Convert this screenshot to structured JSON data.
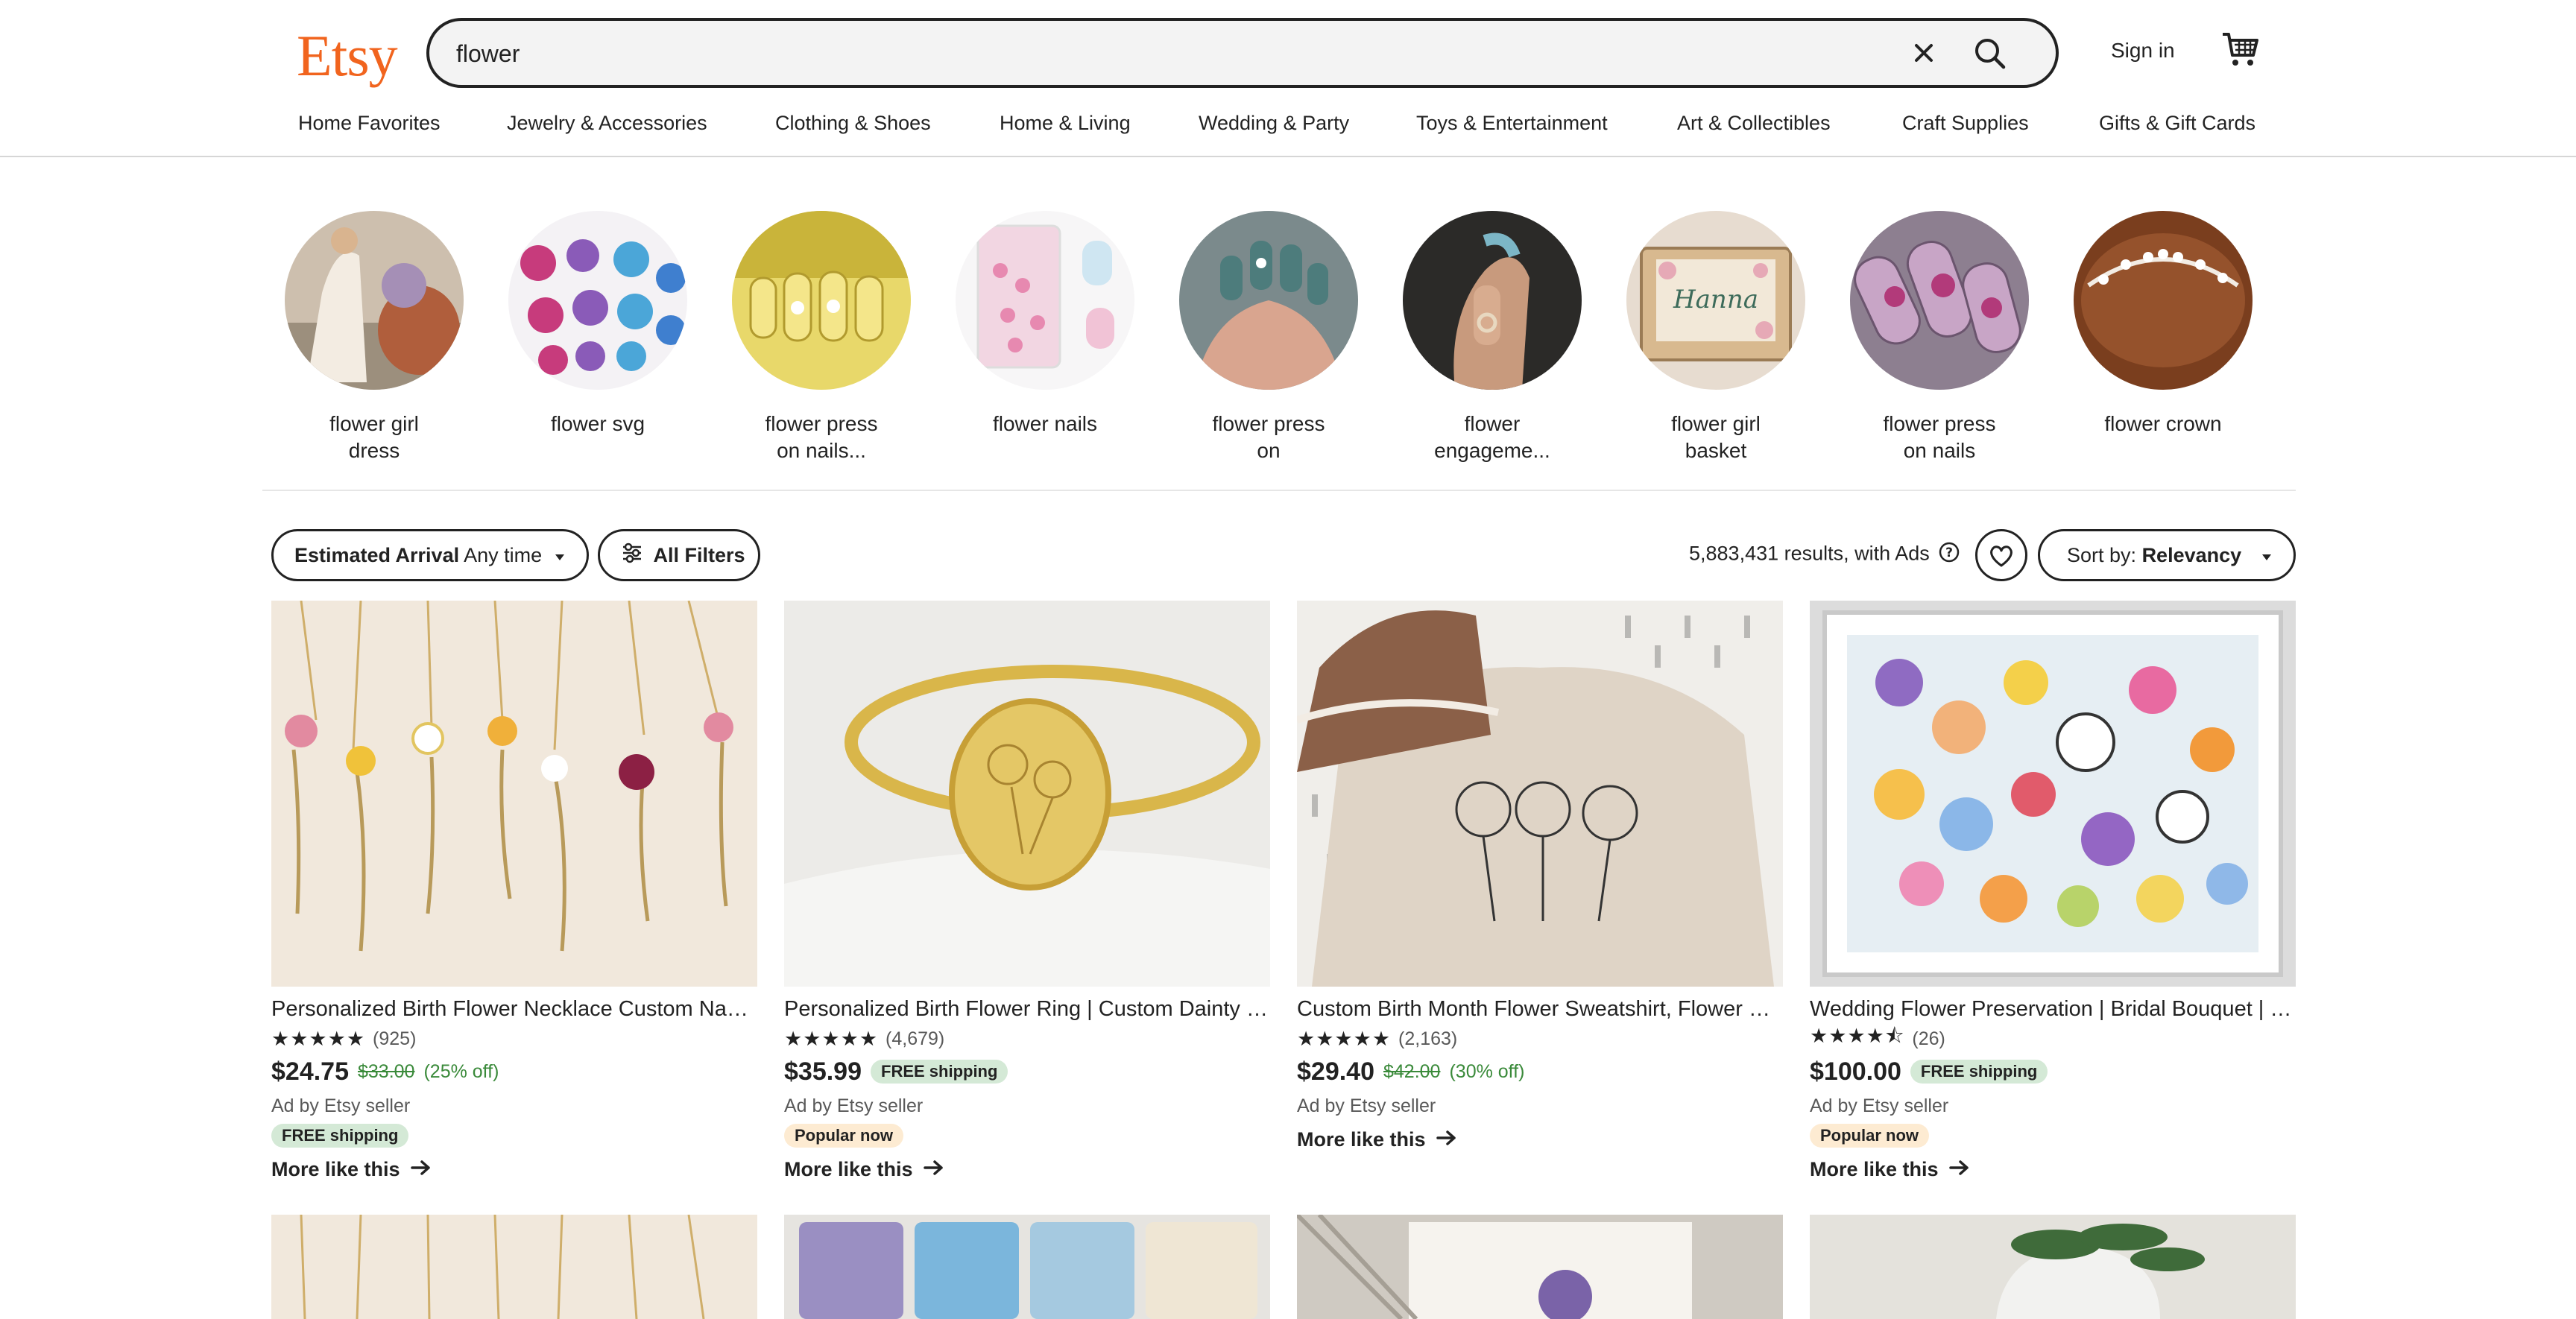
{
  "header": {
    "logo": "Etsy",
    "search": {
      "value": "flower"
    },
    "sign_in": "Sign in",
    "icons": {
      "clear": "close-icon",
      "search": "search-icon",
      "cart": "cart-icon"
    },
    "brand_color": "#f1641e"
  },
  "categories": [
    "Home Favorites",
    "Jewelry & Accessories",
    "Clothing & Shoes",
    "Home & Living",
    "Wedding & Party",
    "Toys & Entertainment",
    "Art & Collectibles",
    "Craft Supplies",
    "Gifts & Gift Cards"
  ],
  "suggestions": [
    {
      "line1": "flower girl",
      "line2": "dress"
    },
    {
      "line1": "flower svg",
      "line2": ""
    },
    {
      "line1": "flower press",
      "line2": "on nails..."
    },
    {
      "line1": "flower nails",
      "line2": ""
    },
    {
      "line1": "flower press",
      "line2": "on"
    },
    {
      "line1": "flower",
      "line2": "engageme..."
    },
    {
      "line1": "flower girl",
      "line2": "basket"
    },
    {
      "line1": "flower press",
      "line2": "on nails"
    },
    {
      "line1": "flower crown",
      "line2": ""
    }
  ],
  "filters": {
    "arrival_label": "Estimated Arrival",
    "arrival_value": "Any time",
    "all_filters": "All Filters",
    "results": "5,883,431 results,",
    "with_ads": "with Ads",
    "sort_label": "Sort by:",
    "sort_value": "Relevancy"
  },
  "listings": [
    {
      "title": "Personalized Birth Flower Necklace Custom Name Necklace",
      "stars": "★★★★★",
      "reviews": "(925)",
      "price": "$24.75",
      "original": "$33.00",
      "discount": "(25% off)",
      "seller": "Ad by Etsy seller",
      "badge": "FREE shipping",
      "more": "More like this"
    },
    {
      "title": "Personalized Birth Flower Ring | Custom Dainty Signet Ring",
      "stars": "★★★★★",
      "reviews": "(4,679)",
      "price": "$35.99",
      "ship_badge": "FREE shipping",
      "seller": "Ad by Etsy seller",
      "badge": "Popular now",
      "more": "More like this"
    },
    {
      "title": "Custom Birth Month Flower Sweatshirt, Flower Bouquet Sweatshirt",
      "stars": "★★★★★",
      "reviews": "(2,163)",
      "price": "$29.40",
      "original": "$42.00",
      "discount": "(30% off)",
      "seller": "Ad by Etsy seller",
      "more": "More like this"
    },
    {
      "title": "Wedding Flower Preservation | Bridal Bouquet | Pressed Flowers",
      "stars": "★★★★⯪",
      "reviews": "(26)",
      "price": "$100.00",
      "ship_badge": "FREE shipping",
      "seller": "Ad by Etsy seller",
      "badge": "Popular now",
      "more": "More like this"
    }
  ],
  "colors": {
    "free_shipping_bg": "#d4e9d6",
    "popular_bg": "#fdebd2",
    "discount_green": "#3a8a3a"
  }
}
